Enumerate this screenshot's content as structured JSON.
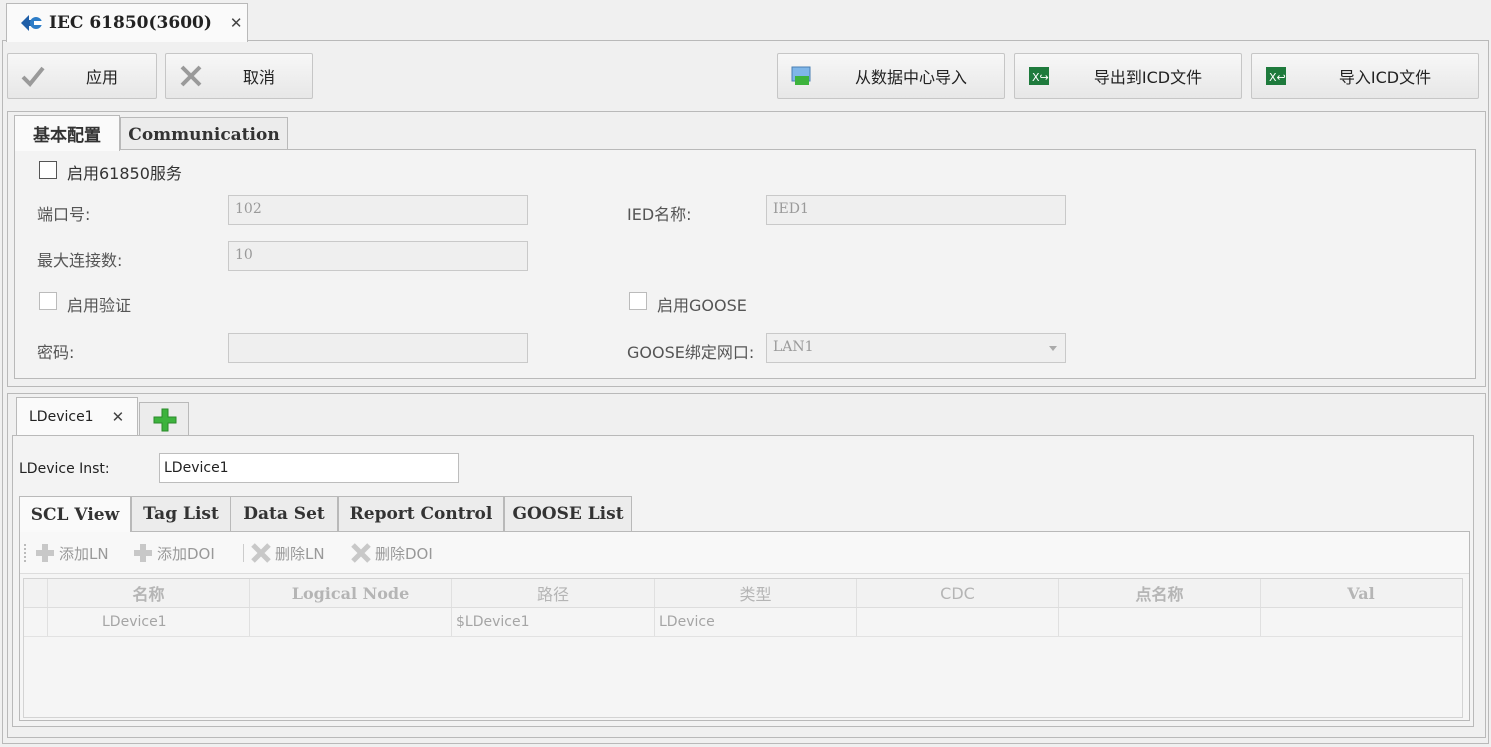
{
  "document_tab": {
    "title": "IEC 61850(3600)",
    "close": "✕"
  },
  "toolbar": {
    "apply": "应用",
    "cancel": "取消",
    "import_from_datacenter": "从数据中心导入",
    "export_icd": "导出到ICD文件",
    "import_icd": "导入ICD文件"
  },
  "config_tabs": [
    "基本配置",
    "Communication"
  ],
  "basic_config": {
    "enable_61850": "启用61850服务",
    "port_label": "端口号:",
    "port_value": "102",
    "ied_name_label": "IED名称:",
    "ied_name_value": "IED1",
    "max_conn_label": "最大连接数:",
    "max_conn_value": "10",
    "enable_auth": "启用验证",
    "enable_goose": "启用GOOSE",
    "password_label": "密码:",
    "password_value": "",
    "goose_if_label": "GOOSE绑定网口:",
    "goose_if_value": "LAN1"
  },
  "device_tab": {
    "label": "LDevice1",
    "close": "✕"
  },
  "device": {
    "inst_label": "LDevice Inst:",
    "inst_value": "LDevice1"
  },
  "sub_tabs": [
    "SCL View",
    "Tag List",
    "Data Set",
    "Report Control",
    "GOOSE List"
  ],
  "grid_toolbar": {
    "add_ln": "添加LN",
    "add_doi": "添加DOI",
    "del_ln": "删除LN",
    "del_doi": "删除DOI"
  },
  "grid": {
    "columns": [
      "名称",
      "Logical Node",
      "路径",
      "类型",
      "CDC",
      "点名称",
      "Val"
    ],
    "rows": [
      [
        "LDevice1",
        "",
        "$LDevice1",
        "LDevice",
        "",
        "",
        ""
      ]
    ]
  },
  "colors": {
    "accent_green": "#3db33d",
    "tab_border": "#b9b9b9",
    "disabled_text": "#a5a5a5"
  }
}
